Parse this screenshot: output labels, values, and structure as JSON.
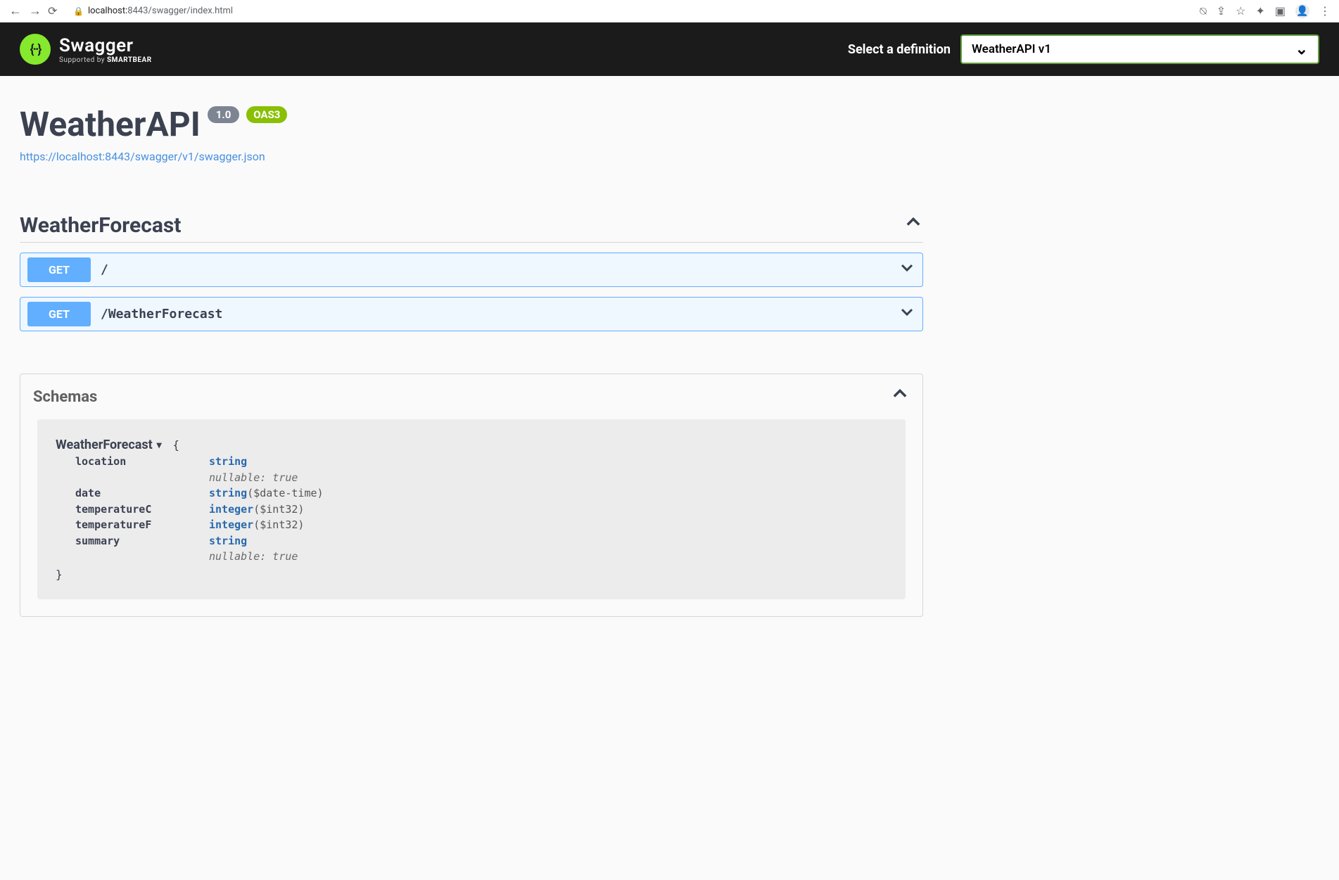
{
  "browser": {
    "url_host": "localhost:",
    "url_port_path": "8443/swagger/index.html"
  },
  "topbar": {
    "brand_main": "Swagger",
    "brand_sub_prefix": "Supported by ",
    "brand_sub_bold": "SMARTBEAR",
    "def_label": "Select a definition",
    "def_selected": "WeatherAPI v1"
  },
  "info": {
    "title": "WeatherAPI",
    "version": "1.0",
    "oas_badge": "OAS3",
    "spec_url": "https://localhost:8443/swagger/v1/swagger.json"
  },
  "tag": {
    "name": "WeatherForecast"
  },
  "operations": [
    {
      "method": "GET",
      "path": "/"
    },
    {
      "method": "GET",
      "path": "/WeatherForecast"
    }
  ],
  "schemas": {
    "header": "Schemas",
    "model": {
      "name": "WeatherForecast",
      "properties": [
        {
          "name": "location",
          "type": "string",
          "format": "",
          "nullable": "nullable: true"
        },
        {
          "name": "date",
          "type": "string",
          "format": "($date-time)",
          "nullable": ""
        },
        {
          "name": "temperatureC",
          "type": "integer",
          "format": "($int32)",
          "nullable": ""
        },
        {
          "name": "temperatureF",
          "type": "integer",
          "format": "($int32)",
          "nullable": ""
        },
        {
          "name": "summary",
          "type": "string",
          "format": "",
          "nullable": "nullable: true"
        }
      ]
    }
  }
}
